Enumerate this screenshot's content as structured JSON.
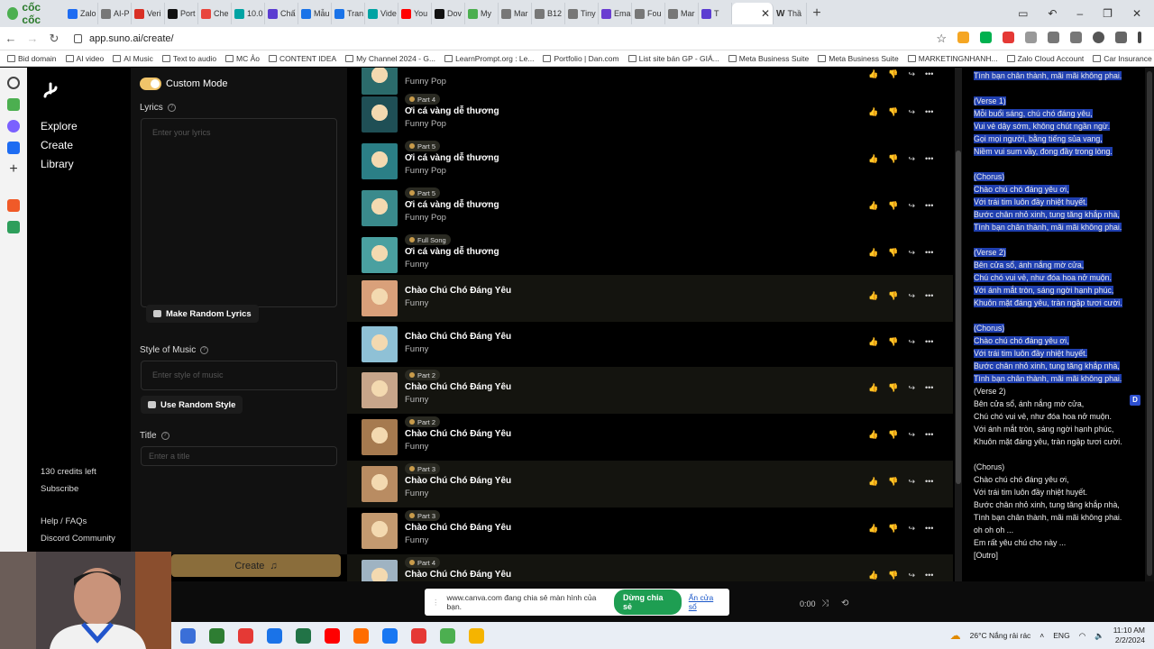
{
  "browser": {
    "brand": "cốc cốc",
    "tabs": [
      {
        "label": "Zalo",
        "color": "#1e6cf2"
      },
      {
        "label": "AI-P",
        "color": "#777777"
      },
      {
        "label": "Veri",
        "color": "#d93025"
      },
      {
        "label": "Port",
        "color": "#111111"
      },
      {
        "label": "Che",
        "color": "#e8453c"
      },
      {
        "label": "10.0",
        "color": "#00a3a3"
      },
      {
        "label": "Chấ",
        "color": "#5b3dd1"
      },
      {
        "label": "Mẫu",
        "color": "#1a73e8"
      },
      {
        "label": "Tran",
        "color": "#1a73e8"
      },
      {
        "label": "Vide",
        "color": "#00a3a3"
      },
      {
        "label": "You",
        "color": "#ff0000"
      },
      {
        "label": "Dov",
        "color": "#111111"
      },
      {
        "label": "My",
        "color": "#4caf50"
      },
      {
        "label": "Mar",
        "color": "#777777"
      },
      {
        "label": "B12",
        "color": "#777777"
      },
      {
        "label": "Tiny",
        "color": "#777777"
      },
      {
        "label": "Ema",
        "color": "#6a3dd1"
      },
      {
        "label": "Fou",
        "color": "#777777"
      },
      {
        "label": "Mar",
        "color": "#777777"
      },
      {
        "label": "T",
        "color": "#5b3dd1"
      }
    ],
    "active_tab_label": "",
    "last_tab_label": "Thầ",
    "new_tab": "+",
    "url": "app.suno.ai/create/",
    "bookmarks": [
      "Bid domain",
      "AI video",
      "AI Music",
      "Text to audio",
      "MC Ảo",
      "CONTENT IDEA",
      "My Channel 2024 - G...",
      "LearnPrompt.org : Le...",
      "Portfolio | Dan.com",
      "List site bán GP - GIÁ...",
      "Meta Business Suite",
      "Meta Business Suite",
      "MARKETINGNHANH...",
      "Zalo Cloud Account",
      "Car Insurance Basics..."
    ]
  },
  "nav": {
    "explore": "Explore",
    "create": "Create",
    "library": "Library",
    "credits": "130 credits left",
    "subscribe": "Subscribe",
    "help": "Help / FAQs",
    "discord": "Discord Community"
  },
  "form": {
    "custom_mode": "Custom Mode",
    "lyrics_label": "Lyrics",
    "lyrics_placeholder": "Enter your lyrics",
    "random_lyrics": "Make Random Lyrics",
    "style_label": "Style of Music",
    "style_placeholder": "Enter style of music",
    "random_style": "Use Random Style",
    "title_label": "Title",
    "title_placeholder": "Enter a title",
    "create_button": "Create"
  },
  "songs": [
    {
      "part": "",
      "title": "",
      "style": "Funny Pop",
      "thumb": "#2b6b6b"
    },
    {
      "part": "Part 4",
      "title": "Ơi cá vàng dễ thương",
      "style": "Funny Pop",
      "thumb": "#1f4f55"
    },
    {
      "part": "Part 5",
      "title": "Ơi cá vàng dễ thương",
      "style": "Funny Pop",
      "thumb": "#2b7f86"
    },
    {
      "part": "Part 5",
      "title": "Ơi cá vàng dễ thương",
      "style": "Funny Pop",
      "thumb": "#3a8a8c"
    },
    {
      "part": "Full Song",
      "title": "Ơi cá vàng dễ thương",
      "style": "Funny",
      "thumb": "#4aa0a0"
    },
    {
      "part": "",
      "title": "Chào Chú Chó Đáng Yêu",
      "style": "Funny",
      "thumb": "#d9a07a"
    },
    {
      "part": "",
      "title": "Chào Chú Chó Đáng Yêu",
      "style": "Funny",
      "thumb": "#8fc1d6"
    },
    {
      "part": "Part 2",
      "title": "Chào Chú Chó Đáng Yêu",
      "style": "Funny",
      "thumb": "#c7a58a"
    },
    {
      "part": "Part 2",
      "title": "Chào Chú Chó Đáng Yêu",
      "style": "Funny",
      "thumb": "#a67a4f"
    },
    {
      "part": "Part 3",
      "title": "Chào Chú Chó Đáng Yêu",
      "style": "Funny",
      "thumb": "#b98c62"
    },
    {
      "part": "Part 3",
      "title": "Chào Chú Chó Đáng Yêu",
      "style": "Funny",
      "thumb": "#c49a70"
    },
    {
      "part": "Part 4",
      "title": "Chào Chú Chó Đáng Yêu",
      "style": "",
      "thumb": "#9fb3c2"
    }
  ],
  "lyrics_selected": "Tình bạn chân thành, mãi mãi không phai.\n\n(Verse 1)\nMỗi buổi sáng, chú chó đáng yêu,\nVui vẻ dậy sớm, không chút ngần ngừ.\nGọi mọi người, bằng tiếng sủa vang,\nNiềm vui sum vầy, đong đầy trong lòng.\n\n(Chorus)\nChào chú chó đáng yêu ơi,\nVới trái tim luôn đầy nhiệt huyết.\nBước chân nhỏ xinh, tung tăng khắp nhà,\nTình bạn chân thành, mãi mãi không phai.\n\n(Verse 2)\nBên cửa sổ, ánh nắng mờ cửa,\nChú chó vui vẻ, như đóa hoa nở muộn.\nVới ánh mắt tròn, sáng ngời hạnh phúc,\nKhuôn mặt đáng yêu, tràn ngập tươi cười.\n\n(Chorus)\nChào chú chó đáng yêu ơi,\nVới trái tim luôn đầy nhiệt huyết.\nBước chân nhỏ xinh, tung tăng khắp nhà,\nTình bạn chân thành, mãi mãi không phai.",
  "lyrics_rest": "\n(Verse 2)\nBên cửa sổ, ánh nắng mờ cửa,\nChú chó vui vẻ, như đóa hoa nở muộn.\nVới ánh mắt tròn, sáng ngời hạnh phúc,\nKhuôn mặt đáng yêu, tràn ngập tươi cười.\n\n(Chorus)\nChào chú chó đáng yêu ơi,\nVới trái tim luôn đầy nhiệt huyết.\nBước chân nhỏ xinh, tung tăng khắp nhà,\nTình bạn chân thành, mãi mãi không phai.\noh oh oh ...\nEm rất yêu chú cho này ...\n[Outro]",
  "d_badge": "D",
  "player": {
    "time": "0:00"
  },
  "share_bar": {
    "message": "www.canva.com đang chia sẻ màn hình của bạn.",
    "stop": "Dừng chia sẻ",
    "hide": "Ẩn cửa sổ"
  },
  "taskbar": {
    "weather": "26°C Nắng rải rác",
    "lang": "ENG",
    "time": "11:10 AM",
    "date": "2/2/2024",
    "apps": [
      "#3a6fd8",
      "#2e7d32",
      "#e53935",
      "#1a73e8",
      "#217346",
      "#ff0000",
      "#ff6d00",
      "#1877f2",
      "#e53935",
      "#4caf50",
      "#f5b400"
    ]
  }
}
